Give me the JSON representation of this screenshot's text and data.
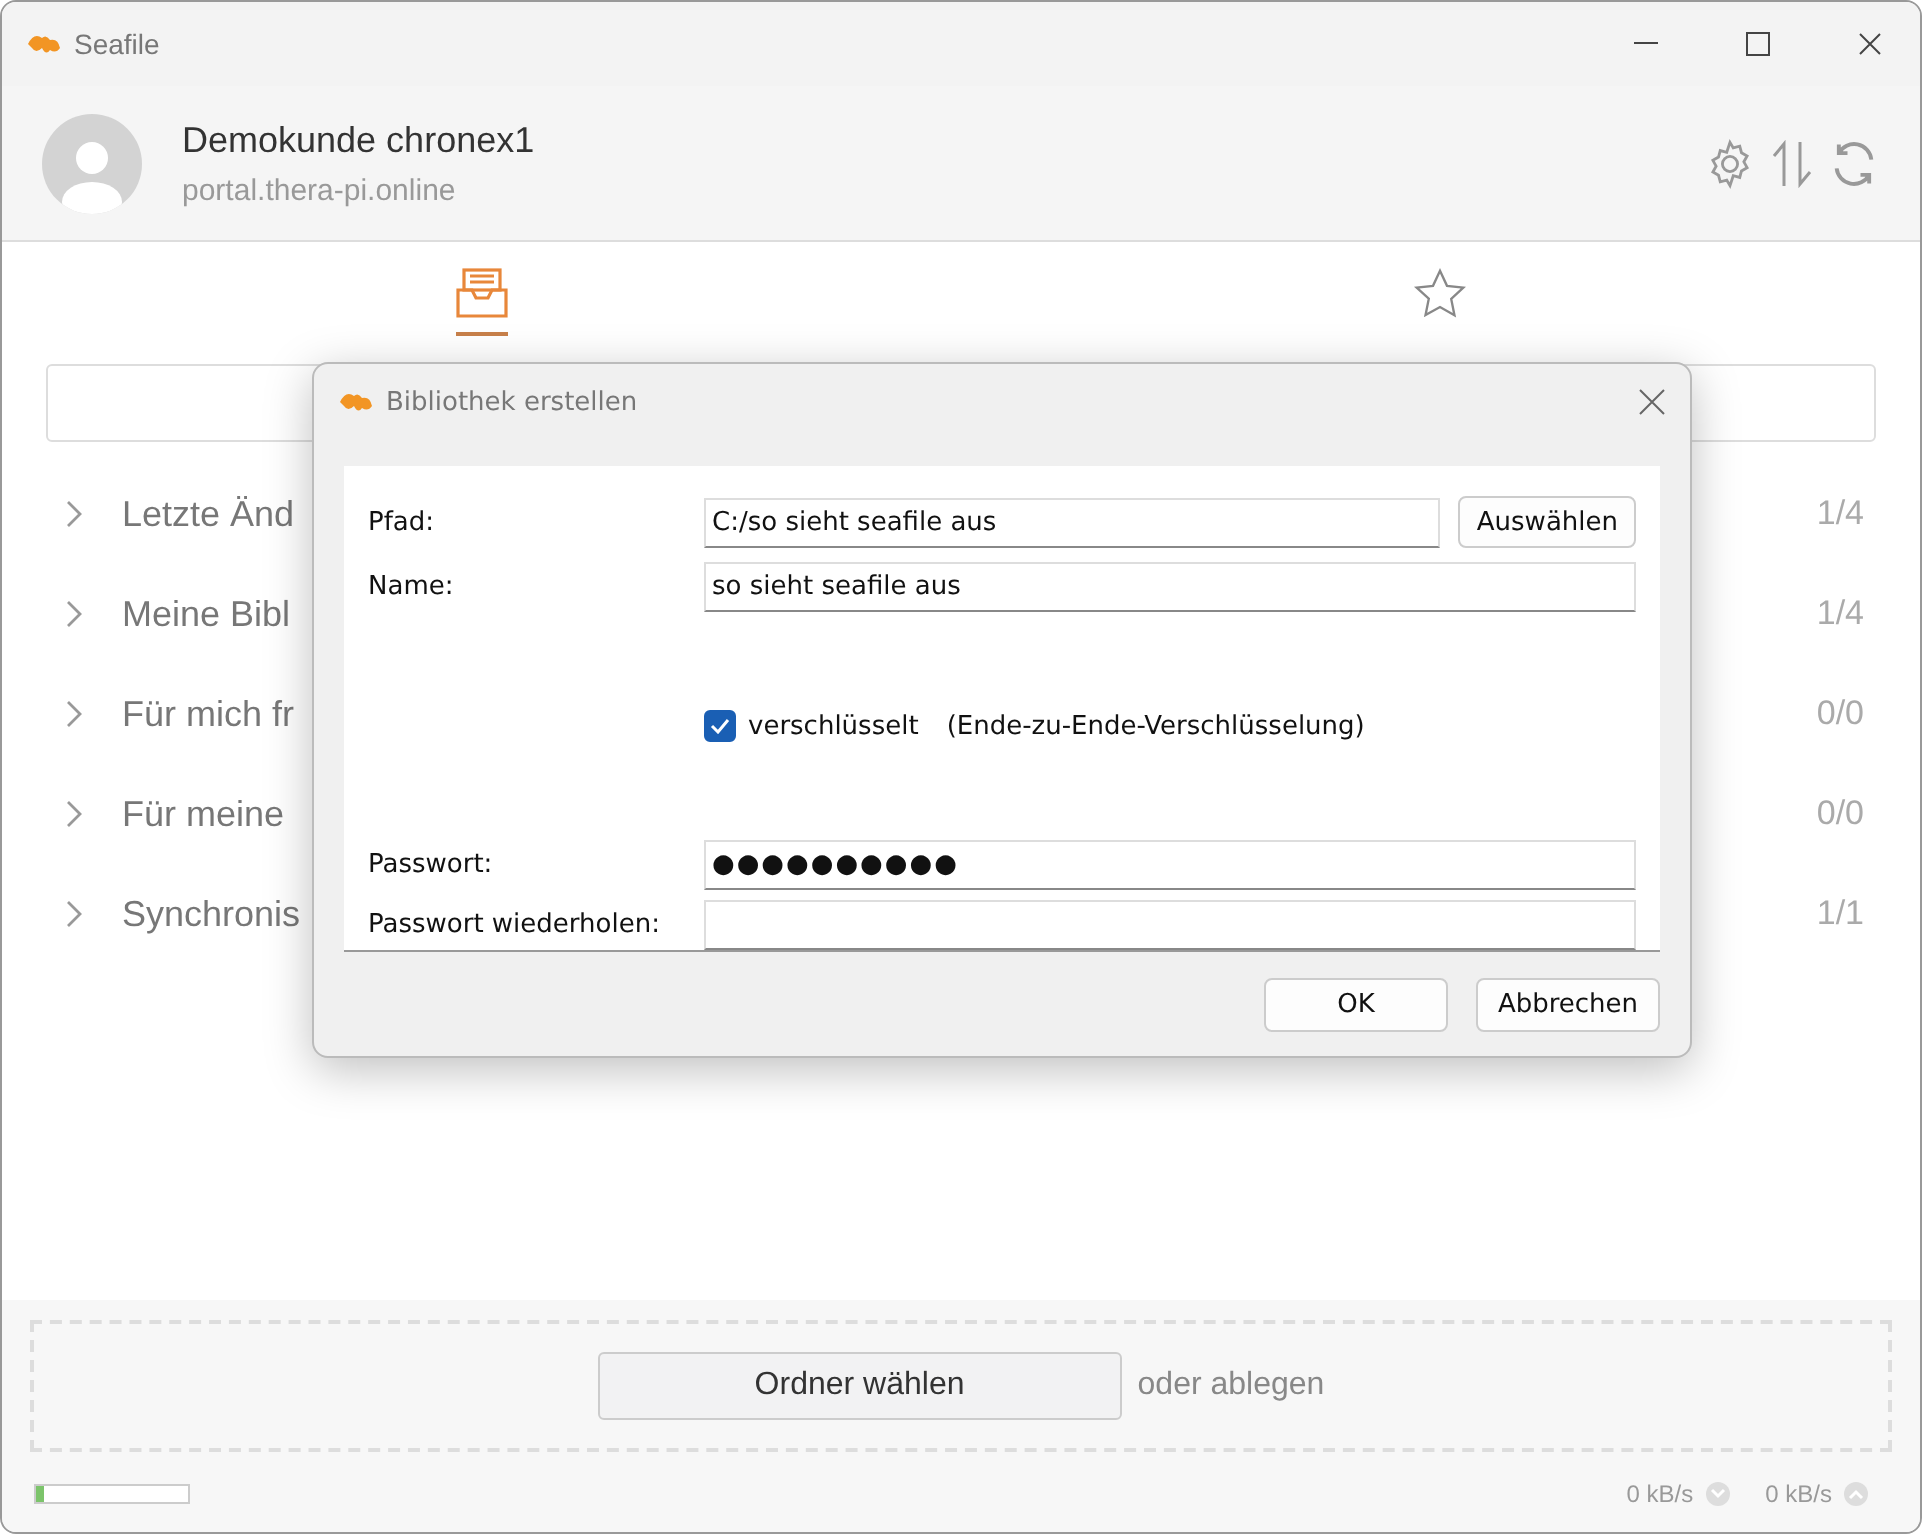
{
  "window": {
    "title": "Seafile"
  },
  "account": {
    "name": "Demokunde chronex1",
    "server": "portal.thera-pi.online"
  },
  "tabs": [
    {
      "kind": "library",
      "selected": true
    },
    {
      "kind": "star",
      "selected": false
    }
  ],
  "sections": [
    {
      "label": "Letzte Änd",
      "count": "1/4"
    },
    {
      "label": "Meine Bibl",
      "count": "1/4"
    },
    {
      "label": "Für mich fr",
      "count": "0/0"
    },
    {
      "label": "Für meine",
      "count": "0/0"
    },
    {
      "label": "Synchronis",
      "count": "1/1"
    }
  ],
  "drop_area": {
    "button": "Ordner wählen",
    "hint": "oder ablegen"
  },
  "status_bar": {
    "level": 0.05,
    "download": "0 kB/s",
    "upload": "0 kB/s"
  },
  "dialog": {
    "title": "Bibliothek erstellen",
    "path": {
      "label": "Pfad:",
      "value": "C:/so sieht seafile aus",
      "button": "Auswählen"
    },
    "name": {
      "label": "Name:",
      "value": "so sieht seafile aus"
    },
    "encrypted": {
      "label": "verschlüsselt",
      "note": "(Ende-zu-Ende-Verschlüsselung)",
      "checked": true
    },
    "password": {
      "label": "Passwort:",
      "value": "●●●●●●●●●●"
    },
    "password_repeat": {
      "label": "Passwort wiederholen:"
    },
    "buttons": [
      "OK",
      "Abbrechen"
    ]
  }
}
